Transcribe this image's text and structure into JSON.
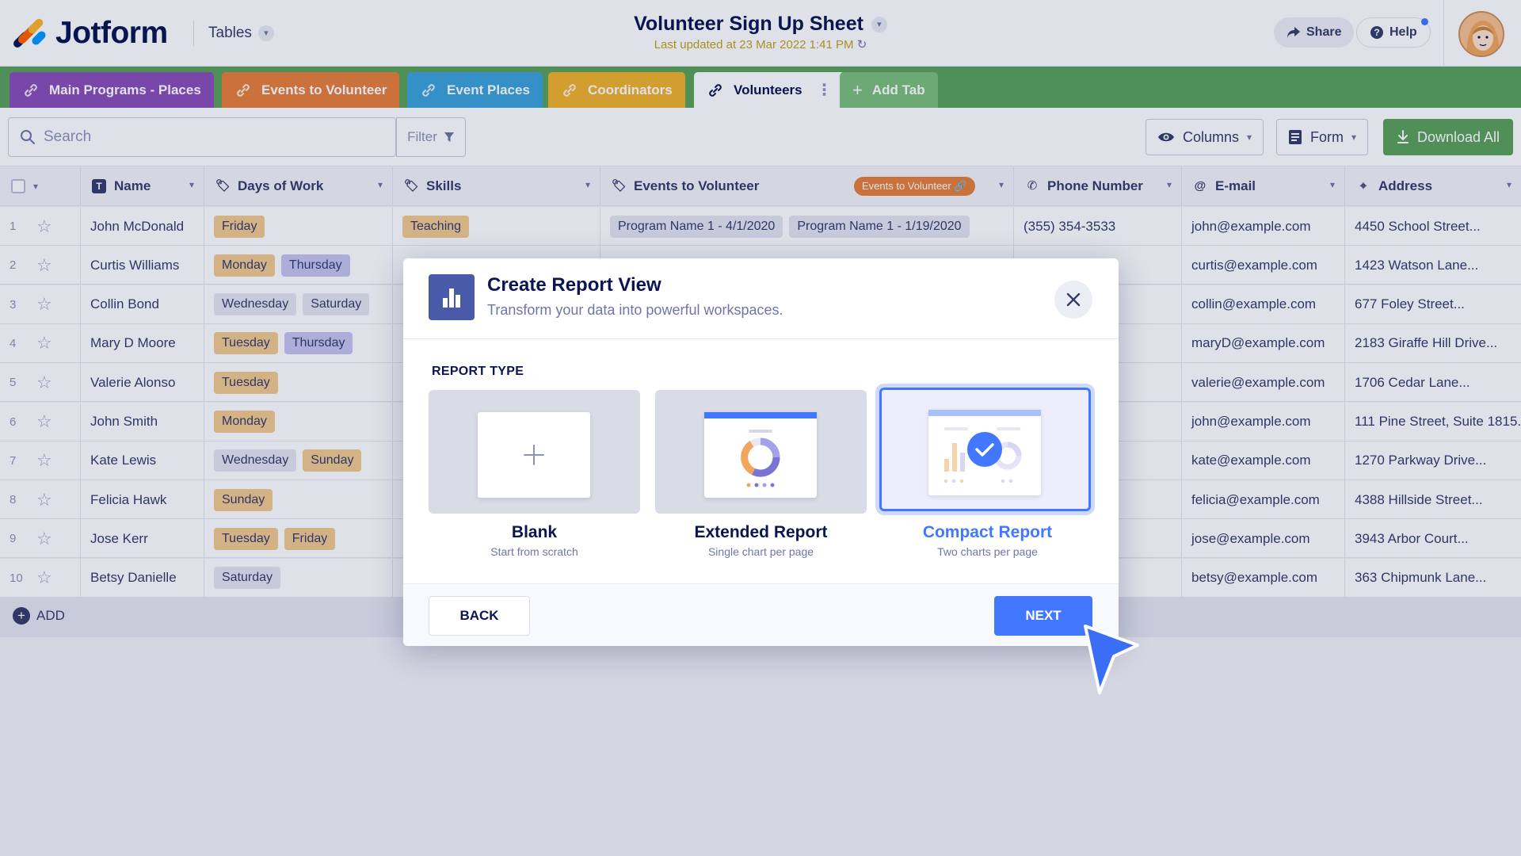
{
  "header": {
    "logo_text": "Jotform",
    "tables_label": "Tables",
    "sheet_title": "Volunteer Sign Up Sheet",
    "last_updated": "Last updated at 23 Mar 2022 1:41 PM",
    "share_label": "Share",
    "help_label": "Help"
  },
  "tabs": [
    {
      "label": "Main Programs - Places",
      "color": "#8a4fb8"
    },
    {
      "label": "Events to Volunteer",
      "color": "#e8803a"
    },
    {
      "label": "Event Places",
      "color": "#3ba3d8"
    },
    {
      "label": "Coordinators",
      "color": "#f0b22c"
    },
    {
      "label": "Volunteers",
      "active": true
    },
    {
      "label": "Add Tab"
    }
  ],
  "toolbar": {
    "search_placeholder": "Search",
    "filter_label": "Filter",
    "columns_label": "Columns",
    "form_label": "Form",
    "download_label": "Download All"
  },
  "columns": {
    "name": "Name",
    "days": "Days of Work",
    "skills": "Skills",
    "events": "Events to Volunteer",
    "events_ref": "Events to Volunteer",
    "phone": "Phone Number",
    "email": "E-mail",
    "address": "Address"
  },
  "rows": [
    {
      "num": "1",
      "name": "John McDonald",
      "days": [
        "Friday"
      ],
      "skill": "Teaching",
      "events": [
        "Program Name 1 - 4/1/2020",
        "Program Name 1 - 1/19/2020"
      ],
      "phone": "(355) 354-3533",
      "email": "john@example.com",
      "address": "4450 School Street..."
    },
    {
      "num": "2",
      "name": "Curtis Williams",
      "days": [
        "Monday",
        "Thursday"
      ],
      "email": "curtis@example.com",
      "address": "1423 Watson Lane..."
    },
    {
      "num": "3",
      "name": "Collin Bond",
      "days": [
        "Wednesday",
        "Saturday"
      ],
      "email": "collin@example.com",
      "address": "677 Foley Street..."
    },
    {
      "num": "4",
      "name": "Mary D Moore",
      "days": [
        "Tuesday",
        "Thursday"
      ],
      "email": "maryD@example.com",
      "address": "2183 Giraffe Hill Drive..."
    },
    {
      "num": "5",
      "name": "Valerie Alonso",
      "days": [
        "Tuesday"
      ],
      "email": "valerie@example.com",
      "address": "1706 Cedar Lane..."
    },
    {
      "num": "6",
      "name": "John Smith",
      "days": [
        "Monday"
      ],
      "email": "john@example.com",
      "address": "111 Pine Street, Suite 1815..."
    },
    {
      "num": "7",
      "name": "Kate Lewis",
      "days": [
        "Wednesday",
        "Sunday"
      ],
      "email": "kate@example.com",
      "address": "1270 Parkway Drive..."
    },
    {
      "num": "8",
      "name": "Felicia Hawk",
      "days": [
        "Sunday"
      ],
      "email": "felicia@example.com",
      "address": "4388 Hillside Street..."
    },
    {
      "num": "9",
      "name": "Jose Kerr",
      "days": [
        "Tuesday",
        "Friday"
      ],
      "email": "jose@example.com",
      "address": "3943 Arbor Court..."
    },
    {
      "num": "10",
      "name": "Betsy Danielle",
      "days": [
        "Saturday"
      ],
      "email": "betsy@example.com",
      "address": "363 Chipmunk Lane..."
    }
  ],
  "add_row_label": "ADD",
  "modal": {
    "title": "Create Report View",
    "subtitle": "Transform your data into powerful workspaces.",
    "section_label": "REPORT TYPE",
    "options": [
      {
        "label": "Blank",
        "sub": "Start from scratch"
      },
      {
        "label": "Extended Report",
        "sub": "Single chart per page"
      },
      {
        "label": "Compact Report",
        "sub": "Two charts per page",
        "selected": true
      }
    ],
    "back_label": "BACK",
    "next_label": "NEXT"
  },
  "colors": {
    "accent": "#4277ff",
    "tabs_bar": "#5ba35a",
    "navy": "#0a1551"
  }
}
